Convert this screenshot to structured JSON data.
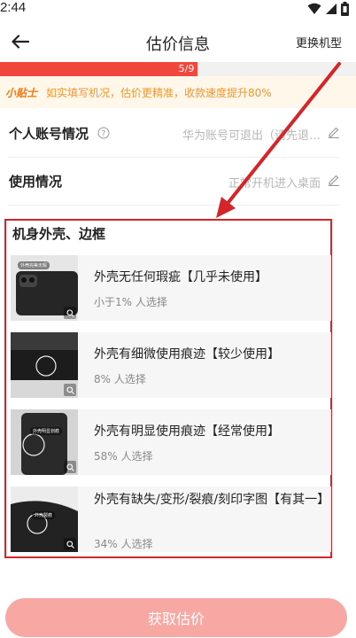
{
  "status": {
    "time": "2:44"
  },
  "nav": {
    "title": "估价信息",
    "action": "更换机型"
  },
  "progress": {
    "text": "5/9",
    "fraction": 0.5556
  },
  "tips": {
    "badge": "小贴士",
    "text": "如实填写机况，估价更精准，收款速度提升80%"
  },
  "rows": [
    {
      "label": "个人账号情况",
      "value": "华为账号可退出（请先退…"
    },
    {
      "label": "使用情况",
      "value": "正常开机进入桌面"
    }
  ],
  "section": {
    "title": "机身外壳、边框",
    "options": [
      {
        "title": "外壳无任何瑕疵【几乎未使用】",
        "sub": "小于1% 人选择",
        "thumb_tag": "外壳完美无瑕"
      },
      {
        "title": "外壳有细微使用痕迹【较少使用】",
        "sub": "8% 人选择",
        "thumb_tag": ""
      },
      {
        "title": "外壳有明显使用痕迹【经常使用】",
        "sub": "58% 人选择",
        "thumb_tag": "外壳明显划痕"
      },
      {
        "title": "外壳有缺失/变形/裂痕/刻印字图【有其一】",
        "sub": "34% 人选择",
        "thumb_tag": "外壳裂痕"
      }
    ]
  },
  "bottom": {
    "button_label": "获取估价"
  },
  "colors": {
    "accent": "#f0463c",
    "annotation": "#d2262a",
    "button": "#f8a8a3",
    "tips_bg": "#fff7e9"
  }
}
